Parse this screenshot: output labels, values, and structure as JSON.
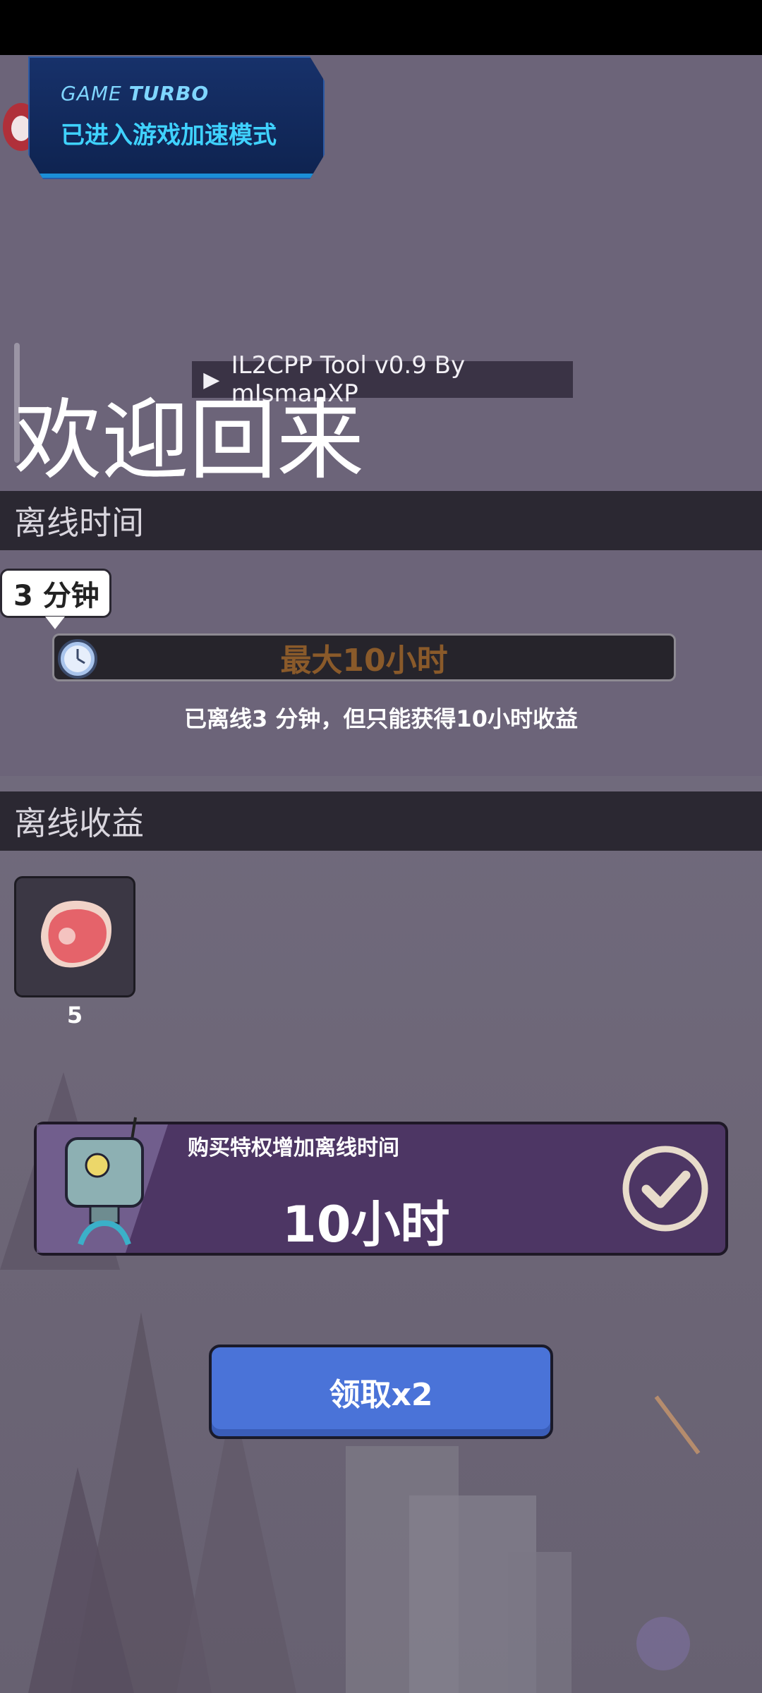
{
  "overlay": {
    "turbo_title_prefix": "GAME ",
    "turbo_title_bold": "TURBO",
    "turbo_message": "已进入游戏加速模式",
    "il2cpp_label": "IL2CPP Tool v0.9 By mIsmanXP"
  },
  "screen": {
    "welcome_title": "欢迎回来"
  },
  "offline_time": {
    "section_title": "离线时间",
    "elapsed_badge": "3 分钟",
    "max_label": "最大10小时",
    "message": "已离线3 分钟，但只能获得10小时收益"
  },
  "offline_rewards": {
    "section_title": "离线收益",
    "items": [
      {
        "icon": "meat-icon",
        "count": "5"
      }
    ]
  },
  "privilege": {
    "label": "购买特权增加离线时间",
    "hours": "10小时",
    "check_icon": "check-circle-icon"
  },
  "claim_button": {
    "label": "领取x2"
  },
  "colors": {
    "section_bar": "#2b2832",
    "privilege_bg": "#4d3664",
    "claim_bg": "#4a73d8",
    "max_label": "#8a5a2a",
    "turbo_text": "#3fd2ff"
  }
}
